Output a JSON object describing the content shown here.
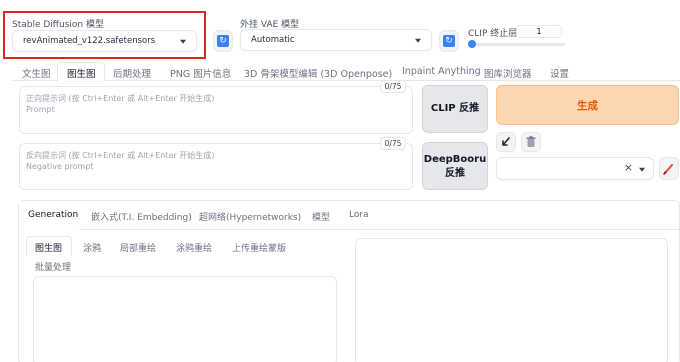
{
  "model": {
    "label": "Stable Diffusion 模型",
    "value": "revAnimated_v122.safetensors"
  },
  "vae": {
    "label": "外挂 VAE 模型",
    "value": "Automatic"
  },
  "clip": {
    "label": "CLIP 终止层数",
    "value": "1",
    "slider_level": 0.0
  },
  "main_tabs": [
    "文生图",
    "图生图",
    "后期处理",
    "PNG 图片信息",
    "3D 骨架模型编辑 (3D Openpose)",
    "Inpaint Anything",
    "图库浏览器",
    "设置"
  ],
  "active_main_tab": "图生图",
  "prompt": {
    "placeholder_line1": "正向提示词 (按 Ctrl+Enter 或 Alt+Enter 开始生成)",
    "placeholder_line2": "Prompt",
    "counter": "0/75"
  },
  "negative_prompt": {
    "placeholder_line1": "反向提示词 (按 Ctrl+Enter 或 Alt+Enter 开始生成)",
    "placeholder_line2": "Negative prompt",
    "counter": "0/75"
  },
  "buttons": {
    "clip_interrogate_line1": "CLIP 反推",
    "deepbooru_line1": "DeepBooru",
    "deepbooru_line2": "反推",
    "generate": "生成"
  },
  "style_select": {
    "clear_symbol": "×"
  },
  "extra_tabs": [
    "Generation",
    "嵌入式(T.I. Embedding)",
    "超网络(Hypernetworks)",
    "模型",
    "Lora"
  ],
  "active_extra_tab": "Generation",
  "img_tabs": [
    "图生图",
    "涂鸦",
    "局部重绘",
    "涂鸦重绘",
    "上传重绘蒙版"
  ],
  "img_tabs_row2": [
    "批量处理"
  ],
  "active_img_tab": "图生图",
  "colors": {
    "highlight_border": "#dc2626",
    "generate_bg": "#fdd7b0",
    "generate_text": "#ea580c",
    "accent_blue": "#3b82f6",
    "pencil_red": "#ef4444"
  },
  "icons": {
    "refresh": "refresh-icon",
    "paste": "arrow-icon",
    "trash": "trash-icon",
    "edit": "pencil-icon"
  }
}
